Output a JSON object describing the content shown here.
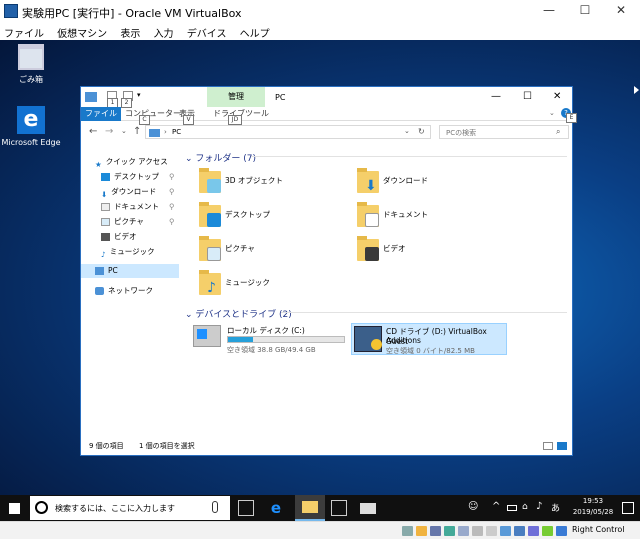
{
  "virtualbox": {
    "title": "実験用PC [実行中] - Oracle VM VirtualBox",
    "menu": [
      "ファイル",
      "仮想マシン",
      "表示",
      "入力",
      "デバイス",
      "ヘルプ"
    ],
    "window_controls": {
      "minimize": "—",
      "maximize": "☐",
      "close": "✕"
    },
    "status": {
      "host_key": "Right Control"
    }
  },
  "desktop": {
    "icons": [
      {
        "label": "ごみ箱"
      },
      {
        "label": "Microsoft Edge"
      }
    ]
  },
  "explorer": {
    "title": "PC",
    "ribbon_context_tab": "管理",
    "tabs": [
      "ファイル",
      "コンピューター",
      "表示",
      "ドライブツール"
    ],
    "key_hints": [
      "1",
      "2",
      "C",
      "V",
      "JD",
      "E"
    ],
    "address": "PC",
    "search_placeholder": "PCの検索",
    "nav": {
      "quick_access": "クイック アクセス",
      "items": [
        "デスクトップ",
        "ダウンロード",
        "ドキュメント",
        "ピクチャ",
        "ビデオ",
        "ミュージック"
      ],
      "pc": "PC",
      "network": "ネットワーク"
    },
    "folders": {
      "header": "フォルダー (7)",
      "items": [
        "3D オブジェクト",
        "ダウンロード",
        "デスクトップ",
        "ドキュメント",
        "ピクチャ",
        "ビデオ",
        "ミュージック"
      ]
    },
    "drives": {
      "header": "デバイスとドライブ (2)",
      "local": {
        "label": "ローカル ディスク (C:)",
        "free": "空き領域 38.8 GB/49.4 GB",
        "used_fraction": 0.215
      },
      "cd": {
        "label": "CD ドライブ (D:) VirtualBox Guest",
        "label2": "Additions",
        "free": "空き領域 0 バイト/82.5 MB"
      }
    },
    "status": {
      "items": "9 個の項目",
      "selected": "1 個の項目を選択"
    }
  },
  "taskbar": {
    "search_placeholder": "検索するには、ここに入力します",
    "time": "19:53",
    "date": "2019/05/28",
    "tray_ime": "あ"
  },
  "colors": {
    "accent": "#0078d7",
    "ribbon_context": "#cfefcf",
    "selected": "#cce8ff"
  }
}
